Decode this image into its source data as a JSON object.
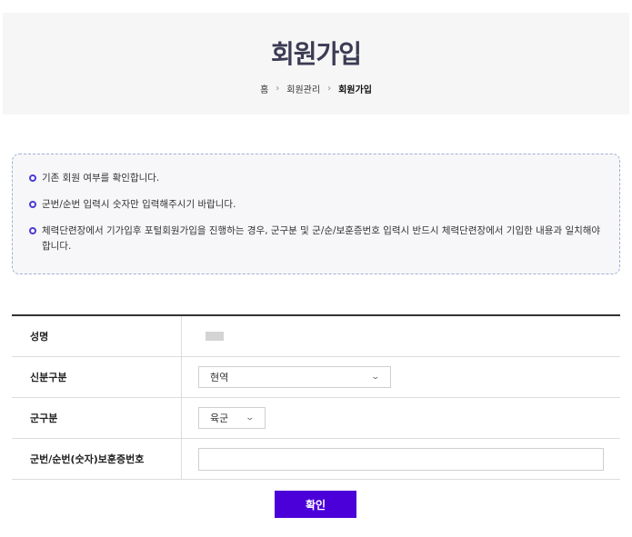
{
  "header": {
    "title": "회원가입",
    "breadcrumb": {
      "home": "홈",
      "separator": "›",
      "section": "회원관리",
      "current": "회원가입"
    }
  },
  "notice": {
    "items": [
      "기존 회원 여부를 확인합니다.",
      "군번/순번 입력시 숫자만 입력해주시기 바랍니다.",
      "체력단련장에서 기가입후 포털회원가입을 진행하는 경우, 군구분 및 군/순/보훈증번호 입력시 반드시 체력단련장에서 기입한 내용과 일치해야 합니다."
    ]
  },
  "form": {
    "name": {
      "label": "성명"
    },
    "status": {
      "label": "신분구분",
      "selected": "현역"
    },
    "branch": {
      "label": "군구분",
      "selected": "육군"
    },
    "service_number": {
      "label": "군번/순번(숫자)보훈증번호",
      "value": "",
      "placeholder": ""
    }
  },
  "actions": {
    "confirm_label": "확인"
  },
  "colors": {
    "accent": "#4b00d9",
    "title": "#3b3b54",
    "bullet": "#4b3bd6"
  }
}
